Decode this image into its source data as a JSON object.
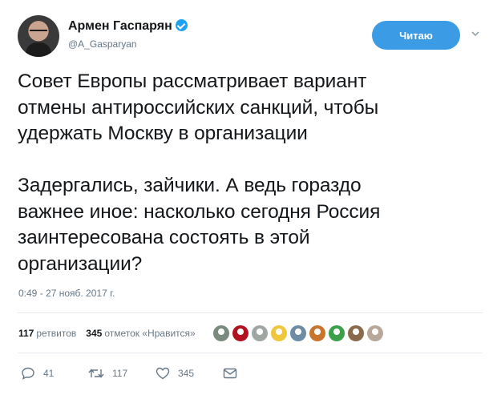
{
  "author": {
    "name": "Армен Гаспарян",
    "handle": "@A_Gasparyan",
    "verified": true,
    "avatar_icon": "user-avatar"
  },
  "follow_button": {
    "label": "Читаю",
    "color": "#3c9be5"
  },
  "menu_icon": "chevron-down-icon",
  "tweet": {
    "text": "Совет Европы рассматривает вариант\nотмены антироссийских санкций, чтобы\nудержать Москву в организации\n\nЗадергались, зайчики. А ведь гораздо\nважнее иное: насколько сегодня Россия\nзаинтересована состоять в этой\nорганизации?",
    "timestamp": "0:49 - 27 нояб. 2017 г."
  },
  "stats": {
    "retweets_count": "117",
    "retweets_label": "ретвитов",
    "likes_count": "345",
    "likes_label": "отметок «Нравится»",
    "liker_avatar_colors": [
      "#7a8a7c",
      "#b3121e",
      "#9fa7a3",
      "#f0c63b",
      "#6d8ba3",
      "#c9742b",
      "#3aa14a",
      "#8a6a4a",
      "#b7a89a"
    ]
  },
  "actions": {
    "reply_count": "41",
    "retweet_count": "117",
    "like_count": "345",
    "accent_color": "#17bf63"
  }
}
